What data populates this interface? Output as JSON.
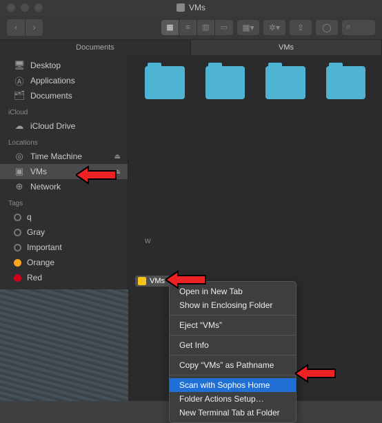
{
  "window": {
    "title": "VMs"
  },
  "tabs": [
    {
      "label": "Documents",
      "active": false
    },
    {
      "label": "VMs",
      "active": true
    }
  ],
  "sidebar": {
    "favorites": [
      {
        "label": "Desktop",
        "icon": "🖥"
      },
      {
        "label": "Applications",
        "icon": "A"
      },
      {
        "label": "Documents",
        "icon": "🗂"
      }
    ],
    "icloud_header": "iCloud",
    "icloud": [
      {
        "label": "iCloud Drive",
        "icon": "☁"
      }
    ],
    "locations_header": "Locations",
    "locations": [
      {
        "label": "Time Machine",
        "icon": "◎",
        "eject": true
      },
      {
        "label": "VMs",
        "icon": "▣",
        "eject": true,
        "selected": true
      },
      {
        "label": "Network",
        "icon": "⊕"
      }
    ],
    "tags_header": "Tags",
    "tags": [
      {
        "label": "q",
        "color": ""
      },
      {
        "label": "Gray",
        "color": ""
      },
      {
        "label": "Important",
        "color": ""
      },
      {
        "label": "Orange",
        "color": "orange"
      },
      {
        "label": "Red",
        "color": "red"
      }
    ]
  },
  "content": {
    "loose_label": "w"
  },
  "pathbar": {
    "label": "VMs"
  },
  "context_menu": {
    "items": [
      {
        "label": "Open in New Tab",
        "type": "item"
      },
      {
        "label": "Show in Enclosing Folder",
        "type": "item"
      },
      {
        "type": "sep"
      },
      {
        "label": "Eject “VMs”",
        "type": "item"
      },
      {
        "type": "sep"
      },
      {
        "label": "Get Info",
        "type": "item"
      },
      {
        "type": "sep"
      },
      {
        "label": "Copy “VMs” as Pathname",
        "type": "item"
      },
      {
        "type": "sep"
      },
      {
        "label": "Scan with Sophos Home",
        "type": "item",
        "selected": true
      },
      {
        "label": "Folder Actions Setup…",
        "type": "item"
      },
      {
        "label": "New Terminal Tab at Folder",
        "type": "item"
      }
    ]
  },
  "annotations": {
    "arrow_color": "#ed2224",
    "arrow_outline": "#000000"
  }
}
